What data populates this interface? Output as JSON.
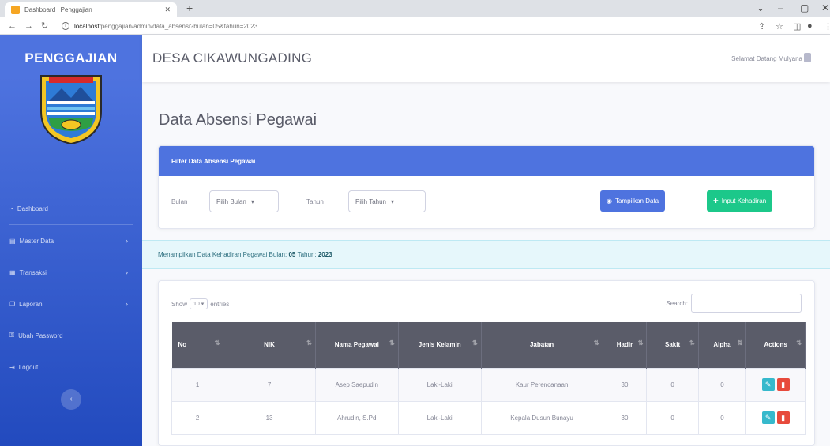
{
  "browser": {
    "tab_title": "Dashboard | Penggajian",
    "url_host": "localhost",
    "url_path": "/penggajian/admin/data_absensi?bulan=05&tahun=2023"
  },
  "sidebar": {
    "brand": "PENGGAJIAN",
    "logo_text": "KAB. PURWAKARTA",
    "items": [
      {
        "label": "Dashboard",
        "icon": "tachometer-icon",
        "has_children": false
      },
      {
        "label": "Master Data",
        "icon": "database-icon",
        "has_children": true
      },
      {
        "label": "Transaksi",
        "icon": "table-icon",
        "has_children": true
      },
      {
        "label": "Laporan",
        "icon": "copy-icon",
        "has_children": true
      },
      {
        "label": "Ubah Password",
        "icon": "lock-icon",
        "has_children": false
      },
      {
        "label": "Logout",
        "icon": "sign-out-icon",
        "has_children": false
      }
    ]
  },
  "topbar": {
    "title": "DESA CIKAWUNGADING",
    "greeting": "Selamat Datang Mulyana"
  },
  "page": {
    "heading": "Data Absensi Pegawai"
  },
  "filter": {
    "title": "Filter Data Absensi Pegawai",
    "bulan_label": "Bulan",
    "bulan_value": "Pilih Bulan",
    "tahun_label": "Tahun",
    "tahun_value": "Pilih Tahun",
    "show_button": "Tampilkan Data",
    "input_button": "Input Kehadiran"
  },
  "alert": {
    "prefix": "Menampilkan Data Kehadiran Pegawai Bulan: ",
    "bulan": "05",
    "mid": " Tahun: ",
    "tahun": "2023"
  },
  "table": {
    "show_label": "Show",
    "length_value": "10",
    "entries_label": "entries",
    "search_label": "Search:",
    "columns": [
      "No",
      "NIK",
      "Nama Pegawai",
      "Jenis Kelamin",
      "Jabatan",
      "Hadir",
      "Sakit",
      "Alpha",
      "Actions"
    ],
    "rows": [
      {
        "no": "1",
        "nik": "7",
        "nama": "Asep Saepudin",
        "jk": "Laki-Laki",
        "jabatan": "Kaur Perencanaan",
        "hadir": "30",
        "sakit": "0",
        "alpha": "0"
      },
      {
        "no": "2",
        "nik": "13",
        "nama": "Ahrudin, S.Pd",
        "jk": "Laki-Laki",
        "jabatan": "Kepala Dusun Bunayu",
        "hadir": "30",
        "sakit": "0",
        "alpha": "0"
      }
    ]
  },
  "colors": {
    "primary": "#4e73df",
    "success": "#1cc88a",
    "info": "#36b9cc",
    "danger": "#e74a3b",
    "table_head": "#5a5c69"
  }
}
